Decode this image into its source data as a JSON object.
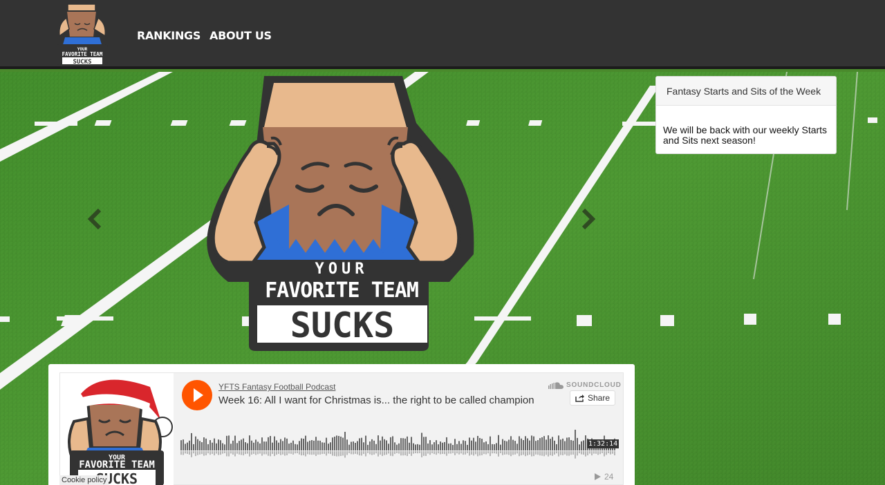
{
  "nav": {
    "logo_alt": "Your Favorite Team Sucks",
    "links": [
      {
        "label": "RANKINGS"
      },
      {
        "label": "ABOUT US"
      }
    ]
  },
  "hero": {
    "logo_line1": "YOUR",
    "logo_line2": "FAVORITE TEAM",
    "logo_line3": "SUCKS"
  },
  "carousel": {
    "prev_icon": "chevron-left-icon",
    "next_icon": "chevron-right-icon"
  },
  "sits": {
    "title": "Fantasy Starts and Sits of the Week",
    "body": "We will be back with our weekly Starts and Sits next season!"
  },
  "podcast": {
    "artist": "YFTS Fantasy Football Podcast",
    "track_title": "Week 16: All I want for Christmas is... the right to be called champion",
    "brand": "SOUNDCLOUD",
    "share_label": "Share",
    "duration": "1:32:14",
    "plays": "24",
    "art_line1": "YOUR",
    "art_line2": "FAVORITE TEAM",
    "art_line3": "SUCKS"
  },
  "cookie": {
    "label": "Cookie policy"
  },
  "colors": {
    "nav_bg": "#333333",
    "turf": "#4a8a2c",
    "soundcloud_orange": "#ff5500",
    "shirt_blue": "#2f6fd6",
    "box_tan": "#e8b98d",
    "face_brown": "#a97558"
  }
}
